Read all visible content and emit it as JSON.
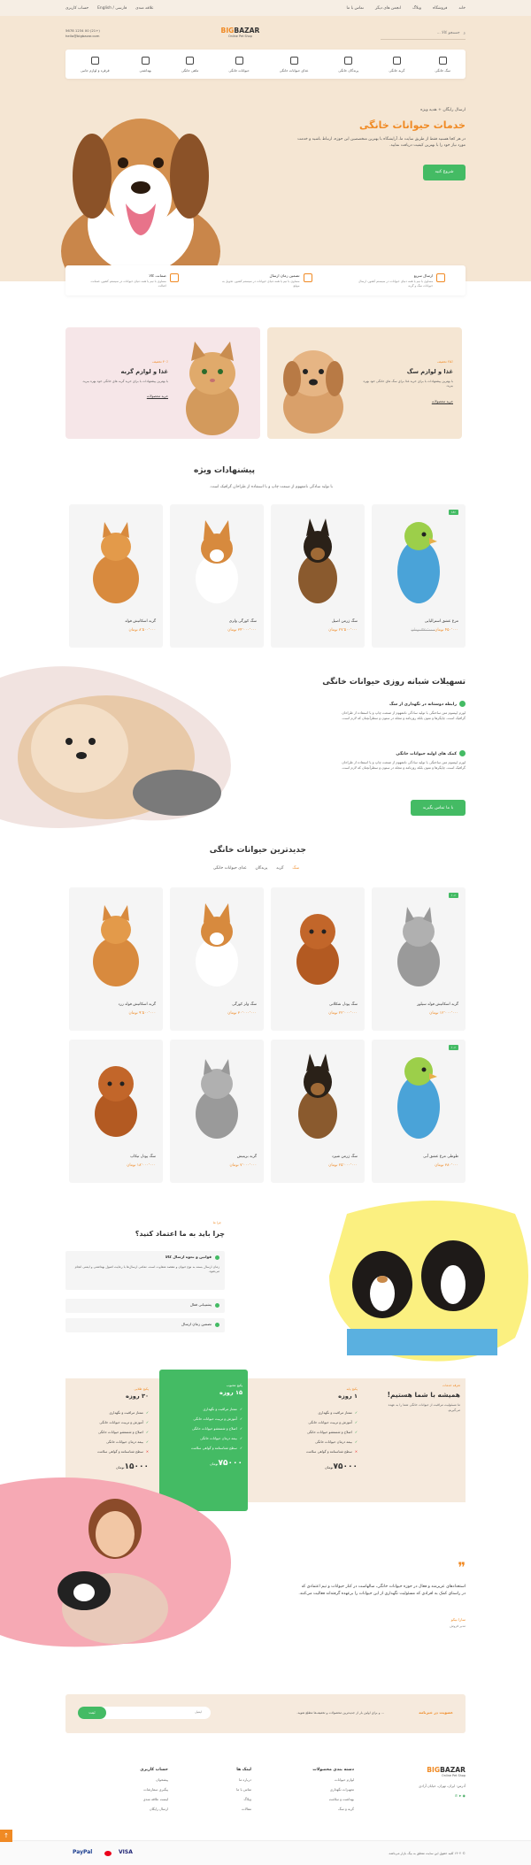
{
  "topbar": {
    "links": [
      "خانه",
      "فروشگاه",
      "وبلاگ",
      "انجمن های دیگر",
      "تماس با ما"
    ],
    "currency": "تومان",
    "language": "فارسی / English",
    "account": "حساب کاربری",
    "wishlist": "علاقه مندی"
  },
  "header": {
    "search_placeholder": "جستجو کالا ...",
    "logo_main_a": "BIG",
    "logo_main_b": "BAZAR",
    "logo_sub": "Online Pet Shop",
    "contact_phone": "(+21) 00 1234 5678",
    "contact_email": "hello@bigbazar.com",
    "contact_label": "پشتیبانی تلفنی"
  },
  "catnav": [
    "سگ خانگی",
    "گربه خانگی",
    "پرندگان خانگی",
    "غذای حیوانات خانگی",
    "حیوانات خانگی",
    "ماهی خانگی",
    "بهداشتی",
    "قرقره و لوازم جانبی"
  ],
  "hero": {
    "crumb": "ارسال رایگان + هدیه ویژه",
    "title": "خدمات حیوانات خانگی",
    "desc": "در هر کجا هستید فقط از طریق سایت ما، آرایشگاه با بهترین متخصصین این حوزه، ارتباط باشید و خدمت مورد نیاز خود را با بهترین کیفیت دریافت نمایید.",
    "cta": "شروع کنید"
  },
  "features": [
    {
      "title": "ارسال سریع",
      "desc": "مساوی با نیم یا همه دنیای حیوانات در سیستم کشور، ارسال حیوانات سگ و گربه"
    },
    {
      "title": "تضمین زمان ارسال",
      "desc": "مساوی با نیم یا همه دنیای حیوانات در سیستم کشور، تحویل به موقع"
    },
    {
      "title": "ضمانت کالا",
      "desc": "مساوی با نیم یا همه دنیای حیوانات در سیستم کشور، ضمانت اصالت"
    }
  ],
  "banners": [
    {
      "tag": "۲۵٪ تخفیف",
      "title": "غذا و لوازم سگ",
      "desc": "با بهترین پیشنهادات با برای خرید غذا برای سگ های خانگی خود بهره ببرید.",
      "link": "خرید محصولات"
    },
    {
      "tag": "۴۰٪ تخفیف",
      "title": "غذا و لوازم گربه",
      "desc": "با بهترین پیشنهادات با برای خرید گربه های خانگی خود بهره ببرید.",
      "link": "خرید محصولات"
    }
  ],
  "special": {
    "title": "پیشنهادات ویژه",
    "sub": "با تولید سادگی نامفهوم از صنعت چاپ و با استفاده از طراحان گرافیک است.",
    "products": [
      {
        "name": "مرغ عشق استرالیایی",
        "price": "۴۵۰٬۰۰۰ تومان",
        "old": "۵۲۰٬۰۰۰ تومان",
        "badge": "۱۸٪"
      },
      {
        "name": "سگ ژرمن اصیل",
        "price": "۲۷٬۵۰۰٬۰۰۰ تومان",
        "old": "",
        "badge": ""
      },
      {
        "name": "سگ کورگی ولزی",
        "price": "۳۴٬۰۰۰٬۰۰۰ تومان",
        "old": "",
        "badge": ""
      },
      {
        "name": "گربه اسکاتیش فولد",
        "price": "۸٬۵۰۰٬۰۰۰ تومان",
        "old": "",
        "badge": ""
      }
    ]
  },
  "facilities": {
    "title": "تسهیلات شبانه روزی حیوانات خانگی",
    "items": [
      {
        "h": "رابطه دوستانه در نگهداری از سگ",
        "p": "لورم ایپسوم متن ساختگی با تولید سادگی نامفهوم از صنعت چاپ و با استفاده از طراحان گرافیک است، چاپگرها و متون بلکه روزنامه و مجله در ستون و سطرآنچنان که لازم است."
      },
      {
        "h": "کمک های اولیه حیوانات خانگی",
        "p": "لورم ایپسوم متن ساختگی با تولید سادگی نامفهوم از صنعت چاپ و با استفاده از طراحان گرافیک است، چاپگرها و متون بلکه روزنامه و مجله در ستون و سطرآنچنان که لازم است."
      }
    ],
    "cta": "با ما تماس بگیرید"
  },
  "newest": {
    "title": "جدیدترین حیوانات خانگی",
    "tabs": [
      "سگ",
      "گربه",
      "پرندگان",
      "غذای حیوانات خانگی"
    ],
    "products": [
      {
        "name": "گربه اسکاتیش فولد سیلور",
        "price": "۱۲٬۰۰۰٬۰۰۰ تومان",
        "badge": "۱۰٪"
      },
      {
        "name": "سگ پودل شکلاتی",
        "price": "۲۲٬۰۰۰٬۰۰۰ تومان",
        "badge": ""
      },
      {
        "name": "سگ ولز کورگی",
        "price": "۳۰٬۰۰۰٬۰۰۰ تومان",
        "badge": ""
      },
      {
        "name": "گربه اسکاتیش فولد زرد",
        "price": "۹٬۵۰۰٬۰۰۰ تومان",
        "badge": ""
      },
      {
        "name": "طوطی مرغ عشق آبی",
        "price": "۳۸۰٬۰۰۰ تومان",
        "badge": "۱۰٪"
      },
      {
        "name": "سگ ژرمن شپرد",
        "price": "۲۵٬۰۰۰٬۰۰۰ تومان",
        "badge": ""
      },
      {
        "name": "گربه بریتیش",
        "price": "۷٬۰۰۰٬۰۰۰ تومان",
        "badge": ""
      },
      {
        "name": "سگ پودل تیکاپ",
        "price": "۱۸٬۰۰۰٬۰۰۰ تومان",
        "badge": ""
      }
    ]
  },
  "why": {
    "tag": "چرا ما",
    "title": "چرا باید به ما اعتماد کنید؟",
    "items": [
      {
        "q": "قوانین و نحوه ارسال کالا",
        "a": "زمان ارسال بسته به نوع حیوان و مقصد متفاوت است. تمامی ارسال‌ها با رعایت اصول بهداشتی و ایمنی انجام می‌شود."
      },
      {
        "q": "پشتیبانی فعال"
      },
      {
        "q": "تضمین زمان ارسال"
      }
    ]
  },
  "pricing": {
    "tag": "تعرفه خدمات",
    "title": "همیشه با شما هستیم!",
    "desc": "ما مسئولیت مراقبت از حیوانات خانگی شما را به عهده می‌گیریم.",
    "plans": [
      {
        "tag": "پکیج پایه",
        "title": "۱ روزه",
        "features": [
          "ممتاز مراقبت و نگهداری",
          "آموزش و تربیت حیوانات خانگی",
          "اصلاح و شستشو حیوانات خانگی",
          "بیمه درمان حیوانات خانگی",
          "پیشرفته",
          "سطح شناسنامه و گواهی سلامت"
        ],
        "price": "۷۵۰۰۰",
        "unit": "تومان"
      },
      {
        "tag": "پکیج محبوب",
        "title": "۱۵ روزه",
        "features": [
          "ممتاز مراقبت و نگهداری",
          "آموزش و تربیت حیوانات خانگی",
          "اصلاح و شستشو حیوانات خانگی",
          "بیمه درمان حیوانات خانگی",
          "پیشرفته",
          "سطح شناسنامه و گواهی سلامت"
        ],
        "price": "۷۵۰۰۰",
        "unit": "تومان"
      },
      {
        "tag": "پکیج طلایی",
        "title": "۳۰ روزه",
        "features": [
          "ممتاز مراقبت و نگهداری",
          "آموزش و تربیت حیوانات خانگی",
          "اصلاح و شستشو حیوانات خانگی",
          "بیمه درمان حیوانات خانگی",
          "پیشرفته",
          "سطح شناسنامه و گواهی سلامت"
        ],
        "price": "۱۵۰۰۰",
        "unit": "تومان"
      }
    ]
  },
  "testimonial": {
    "quote": "استعدادهای عزیزمند و فعال در حوزه حیوانات خانگی، سالهاست در کنار حیوانات و تیم اعتمادی که در راستای کمک به افرادی که مسئولیت نگهداری از این حیوانات را برعهده گرفته‌اند فعالیت می‌کنند.",
    "name": "سارا نیکو",
    "role": "مدیر فروش"
  },
  "newsletter": {
    "title": "عضویت در خبرنامه",
    "desc": "... و برای اولین بار از جدیدترین محصولات و تخفیف‌ها مطلع شوید.",
    "placeholder": "ایمیل",
    "button": "ثبت"
  },
  "footer": {
    "logo_a": "BIG",
    "logo_b": "BAZAR",
    "logo_sub": "Online Pet Shop",
    "address": "آدرس: ایران، تهران، خیابان آزادی",
    "cols": [
      {
        "h": "دسته بندی محصولات",
        "links": [
          "لوازم حیوانات",
          "تجهیزات نگهداری",
          "بهداشت و سلامت",
          "گربه و سگ"
        ]
      },
      {
        "h": "لینک ها",
        "links": [
          "درباره ما",
          "تماس با ما",
          "وبلاگ",
          "مقالات"
        ]
      },
      {
        "h": "حساب کاربری",
        "links": [
          "پیشخوان",
          "پیگیری سفارشات",
          "لیست علاقه مندی",
          "ارسال رایگان"
        ]
      }
    ],
    "copyright": "© ۱۴۰۲ کلیه حقوق این سایت متعلق به بیگ بازار می‌باشد.",
    "payments": [
      "PayPal",
      "VISA"
    ]
  }
}
